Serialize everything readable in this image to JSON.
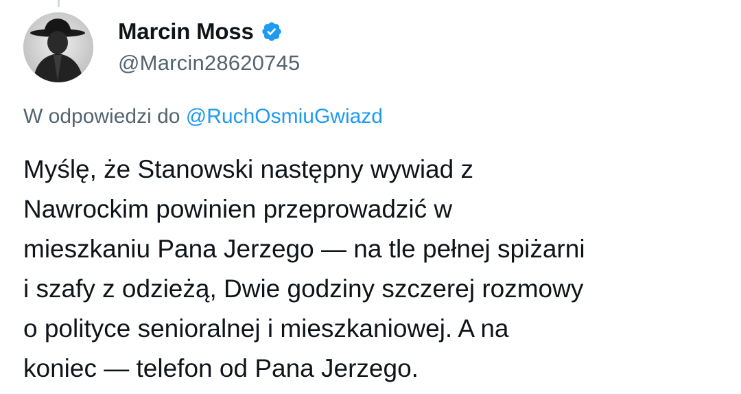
{
  "author": {
    "display_name": "Marcin Moss",
    "handle": "@Marcin28620745",
    "verified": true,
    "avatar_icon": "avatar-silhouette-hat"
  },
  "reply": {
    "prefix": "W odpowiedzi do ",
    "mention": "@RuchOsmiuGwiazd"
  },
  "tweet": {
    "lines": [
      "Myślę, że Stanowski następny wywiad z",
      "Nawrockim powinien przeprowadzić w",
      "mieszkaniu Pana Jerzego — na tle pełnej spiżarni",
      "i szafy z odzieżą, Dwie godziny szczerej rozmowy",
      "o polityce senioralnej i mieszkaniowej. A na",
      "koniec — telefon od Pana Jerzego."
    ]
  },
  "colors": {
    "text": "#0f1419",
    "secondary": "#536471",
    "accent": "#1d9bf0",
    "thread_line": "#cfd9de"
  }
}
